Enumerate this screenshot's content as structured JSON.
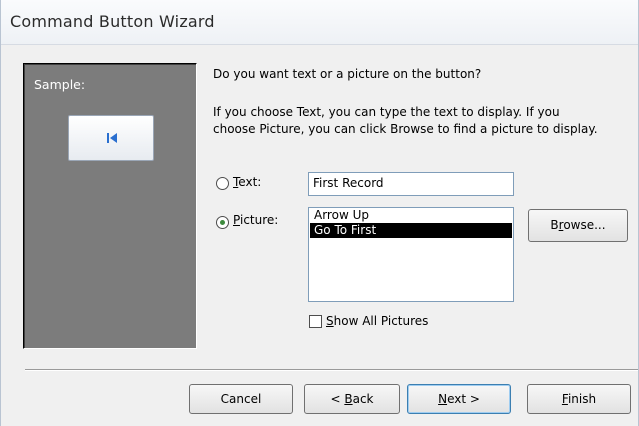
{
  "window": {
    "title": "Command Button Wizard"
  },
  "sample": {
    "label": "Sample:",
    "icon": "first-record-icon"
  },
  "question": "Do you want text or a picture on the button?",
  "instructions": {
    "line1": "If you choose Text, you can type the text to display.  If you",
    "line2": "choose Picture, you can click Browse to find a picture to display."
  },
  "text_option": {
    "label_underlined": "T",
    "label_rest": "ext:",
    "value": "First Record",
    "selected": false
  },
  "picture_option": {
    "label_underlined": "P",
    "label_rest": "icture:",
    "selected": true,
    "items": [
      "Arrow Up",
      "Go To First"
    ],
    "selected_item": "Go To First"
  },
  "browse": {
    "pre": "B",
    "underlined": "r",
    "post": "owse..."
  },
  "show_all": {
    "underlined": "S",
    "rest": "how All Pictures",
    "checked": false
  },
  "buttons": {
    "cancel": "Cancel",
    "back_pre": "< ",
    "back_underlined": "B",
    "back_post": "ack",
    "next_underlined": "N",
    "next_post": "ext >",
    "finish_underlined": "F",
    "finish_post": "inish"
  },
  "colors": {
    "sample_bg": "#7c7c7c",
    "icon": "#2a6fcf",
    "radio_dot": "#3d8a3d",
    "selection": "#000000"
  }
}
